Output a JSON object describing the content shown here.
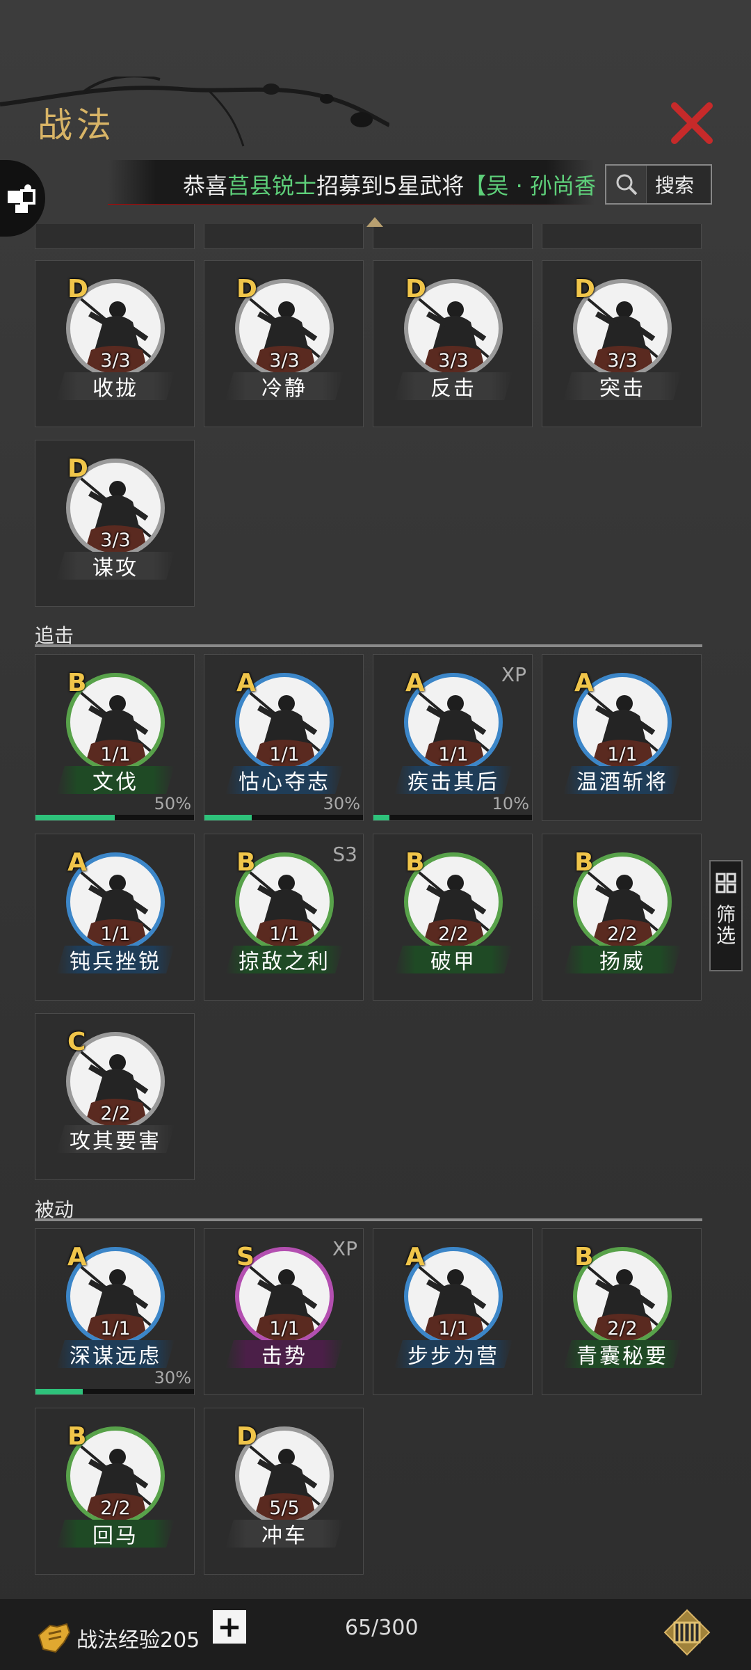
{
  "header": {
    "title": "战法"
  },
  "marquee": {
    "prefix": "恭喜",
    "place": "莒县锐士",
    "middle": "招募到5星武将",
    "hero": "【吴 · 孙尚香 ·"
  },
  "search": {
    "label": "搜索"
  },
  "sections": [
    {
      "label": "追击"
    },
    {
      "label": "被动"
    }
  ],
  "cards": [
    {
      "grade": "D",
      "count": "3/3",
      "name": "收拢",
      "ring": "#9a9a9a",
      "plate": "#3a3a3a"
    },
    {
      "grade": "D",
      "count": "3/3",
      "name": "冷静",
      "ring": "#9a9a9a",
      "plate": "#3a3a3a"
    },
    {
      "grade": "D",
      "count": "3/3",
      "name": "反击",
      "ring": "#9a9a9a",
      "plate": "#3a3a3a"
    },
    {
      "grade": "D",
      "count": "3/3",
      "name": "突击",
      "ring": "#9a9a9a",
      "plate": "#3a3a3a"
    },
    {
      "grade": "D",
      "count": "3/3",
      "name": "谋攻",
      "ring": "#9a9a9a",
      "plate": "#3a3a3a"
    },
    {
      "grade": "B",
      "count": "1/1",
      "name": "文伐",
      "ring": "#58a24a",
      "plate": "#1f4a25",
      "progress": "50%",
      "progress_value": 0.5
    },
    {
      "grade": "A",
      "count": "1/1",
      "name": "怙心夺志",
      "ring": "#3c86c8",
      "plate": "#1f3d58",
      "progress": "30%",
      "progress_value": 0.3
    },
    {
      "grade": "A",
      "count": "1/1",
      "name": "疾击其后",
      "ring": "#3c86c8",
      "plate": "#1f3d58",
      "progress": "10%",
      "progress_value": 0.1,
      "tag": "XP"
    },
    {
      "grade": "A",
      "count": "1/1",
      "name": "温酒斩将",
      "ring": "#3c86c8",
      "plate": "#1f3d58"
    },
    {
      "grade": "A",
      "count": "1/1",
      "name": "钝兵挫锐",
      "ring": "#3c86c8",
      "plate": "#1f3d58"
    },
    {
      "grade": "B",
      "count": "1/1",
      "name": "掠敌之利",
      "ring": "#58a24a",
      "plate": "#1f4a25",
      "tag": "S3"
    },
    {
      "grade": "B",
      "count": "2/2",
      "name": "破甲",
      "ring": "#58a24a",
      "plate": "#1f4a25"
    },
    {
      "grade": "B",
      "count": "2/2",
      "name": "扬威",
      "ring": "#58a24a",
      "plate": "#1f4a25"
    },
    {
      "grade": "C",
      "count": "2/2",
      "name": "攻其要害",
      "ring": "#9a9a9a",
      "plate": "#3a3a3a"
    },
    {
      "grade": "A",
      "count": "1/1",
      "name": "深谋远虑",
      "ring": "#3c86c8",
      "plate": "#1f3d58",
      "progress": "30%",
      "progress_value": 0.3
    },
    {
      "grade": "S",
      "count": "1/1",
      "name": "击势",
      "ring": "#b34fb0",
      "plate": "#4b1f48",
      "tag": "XP"
    },
    {
      "grade": "A",
      "count": "1/1",
      "name": "步步为营",
      "ring": "#3c86c8",
      "plate": "#1f3d58"
    },
    {
      "grade": "B",
      "count": "2/2",
      "name": "青囊秘要",
      "ring": "#58a24a",
      "plate": "#1f4a25"
    },
    {
      "grade": "B",
      "count": "2/2",
      "name": "回马",
      "ring": "#58a24a",
      "plate": "#1f4a25"
    },
    {
      "grade": "D",
      "count": "5/5",
      "name": "冲车",
      "ring": "#9a9a9a",
      "plate": "#3a3a3a"
    }
  ],
  "filter": {
    "label": "筛选"
  },
  "footer": {
    "exp_label": "战法经验205",
    "add_label": "+",
    "capacity": "65/300"
  }
}
